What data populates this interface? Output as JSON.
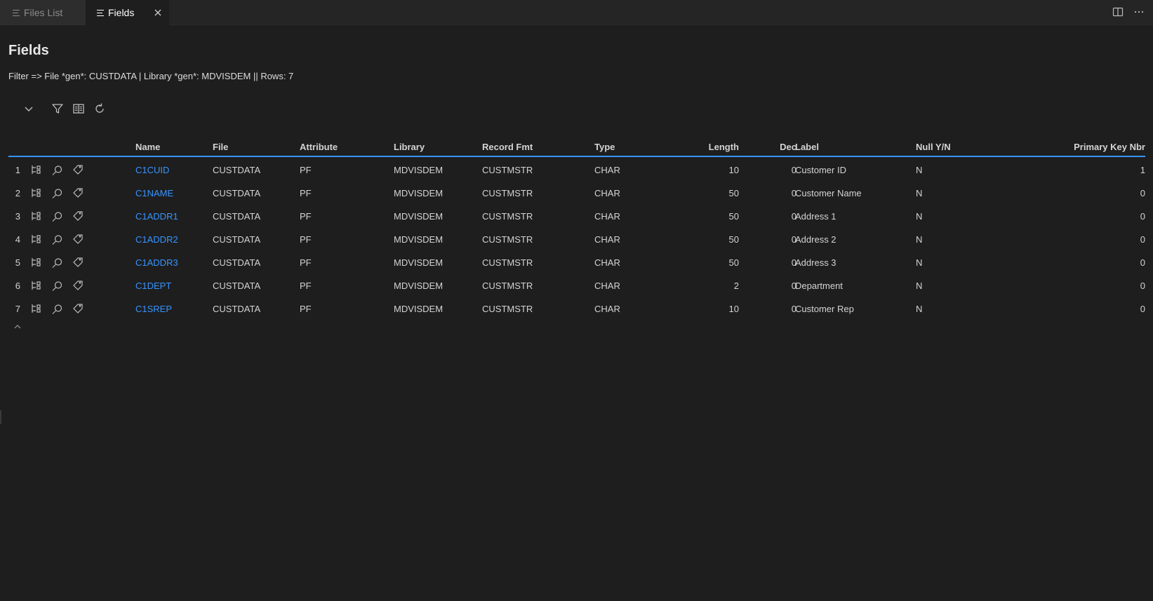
{
  "tabs": [
    {
      "label": "Files List",
      "active": false
    },
    {
      "label": "Fields",
      "active": true
    }
  ],
  "page": {
    "title": "Fields",
    "filter": "Filter => File *gen*: CUSTDATA | Library *gen*: MDVISDEM || Rows: 7"
  },
  "toolbar": {
    "icons": [
      "chevron-down-icon",
      "filter-icon",
      "columns-icon",
      "refresh-icon"
    ]
  },
  "table": {
    "columns": [
      "Name",
      "File",
      "Attribute",
      "Library",
      "Record Fmt",
      "Type",
      "Length",
      "Dec",
      "Label",
      "Null Y/N",
      "Primary Key Nbr"
    ],
    "rows": [
      {
        "num": "1",
        "name": "C1CUID",
        "file": "CUSTDATA",
        "attribute": "PF",
        "library": "MDVISDEM",
        "record_fmt": "CUSTMSTR",
        "type": "CHAR",
        "length": "10",
        "dec": "0",
        "label": "Customer ID",
        "null_yn": "N",
        "pk": "1"
      },
      {
        "num": "2",
        "name": "C1NAME",
        "file": "CUSTDATA",
        "attribute": "PF",
        "library": "MDVISDEM",
        "record_fmt": "CUSTMSTR",
        "type": "CHAR",
        "length": "50",
        "dec": "0",
        "label": "Customer Name",
        "null_yn": "N",
        "pk": "0"
      },
      {
        "num": "3",
        "name": "C1ADDR1",
        "file": "CUSTDATA",
        "attribute": "PF",
        "library": "MDVISDEM",
        "record_fmt": "CUSTMSTR",
        "type": "CHAR",
        "length": "50",
        "dec": "0",
        "label": "Address 1",
        "null_yn": "N",
        "pk": "0"
      },
      {
        "num": "4",
        "name": "C1ADDR2",
        "file": "CUSTDATA",
        "attribute": "PF",
        "library": "MDVISDEM",
        "record_fmt": "CUSTMSTR",
        "type": "CHAR",
        "length": "50",
        "dec": "0",
        "label": "Address 2",
        "null_yn": "N",
        "pk": "0"
      },
      {
        "num": "5",
        "name": "C1ADDR3",
        "file": "CUSTDATA",
        "attribute": "PF",
        "library": "MDVISDEM",
        "record_fmt": "CUSTMSTR",
        "type": "CHAR",
        "length": "50",
        "dec": "0",
        "label": "Address 3",
        "null_yn": "N",
        "pk": "0"
      },
      {
        "num": "6",
        "name": "C1DEPT",
        "file": "CUSTDATA",
        "attribute": "PF",
        "library": "MDVISDEM",
        "record_fmt": "CUSTMSTR",
        "type": "CHAR",
        "length": "2",
        "dec": "0",
        "label": "Department",
        "null_yn": "N",
        "pk": "0"
      },
      {
        "num": "7",
        "name": "C1SREP",
        "file": "CUSTDATA",
        "attribute": "PF",
        "library": "MDVISDEM",
        "record_fmt": "CUSTMSTR",
        "type": "CHAR",
        "length": "10",
        "dec": "0",
        "label": "Customer Rep",
        "null_yn": "N",
        "pk": "0"
      }
    ]
  },
  "colors": {
    "background": "#1e1e1e",
    "link": "#3794ff",
    "header_border": "#3794ff",
    "text": "#d4d4d4"
  }
}
